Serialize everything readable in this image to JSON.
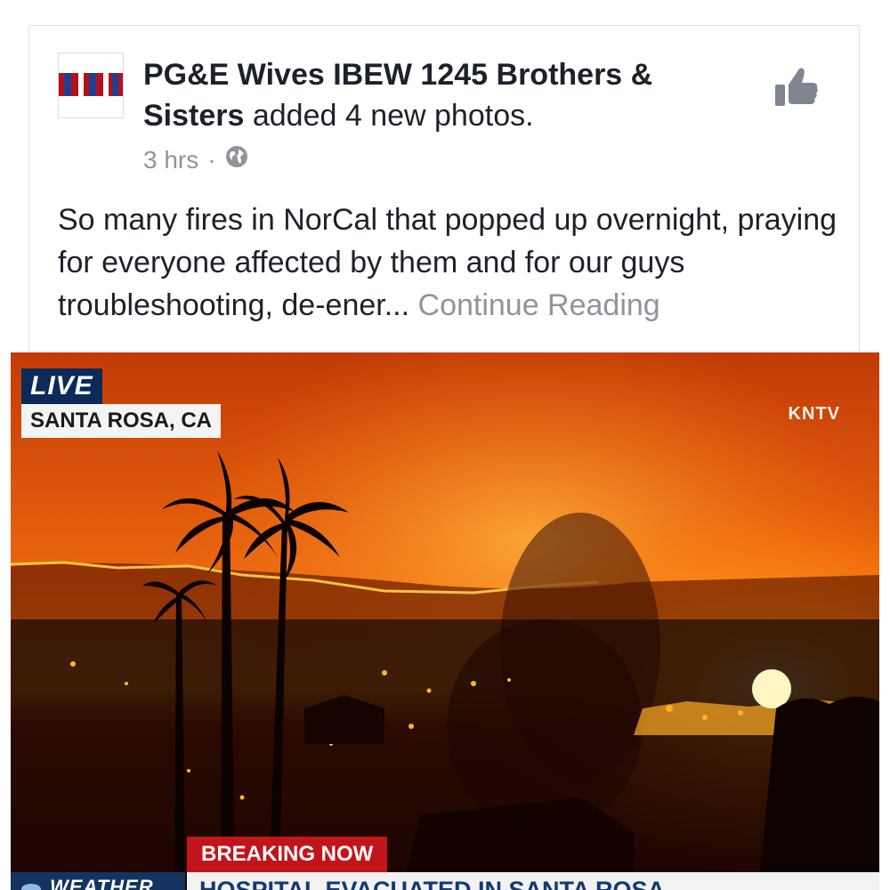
{
  "post": {
    "poster_name": "PG&E Wives IBEW 1245 Brothers & Sisters",
    "action": "added 4 new photos.",
    "time": "3 hrs",
    "separator": "·",
    "text": "So many fires in NorCal that popped up overnight, praying for everyone affected by them and for our guys troubleshooting, de-ener...",
    "continue_label": "Continue Reading"
  },
  "photo": {
    "live_label": "LIVE",
    "location": "SANTA ROSA, CA",
    "station": "KNTV",
    "breaking_label": "BREAKING NOW",
    "headline": "HOSPITAL EVACUATED IN SANTA ROSA",
    "weather_label": "WEATHER"
  },
  "icons": {
    "like": "thumbs-up-icon",
    "privacy": "globe-icon"
  },
  "colors": {
    "meta_gray": "#90949c",
    "text": "#1d2129",
    "breaking_red": "#c2151b",
    "live_blue": "#0b2a5a"
  }
}
